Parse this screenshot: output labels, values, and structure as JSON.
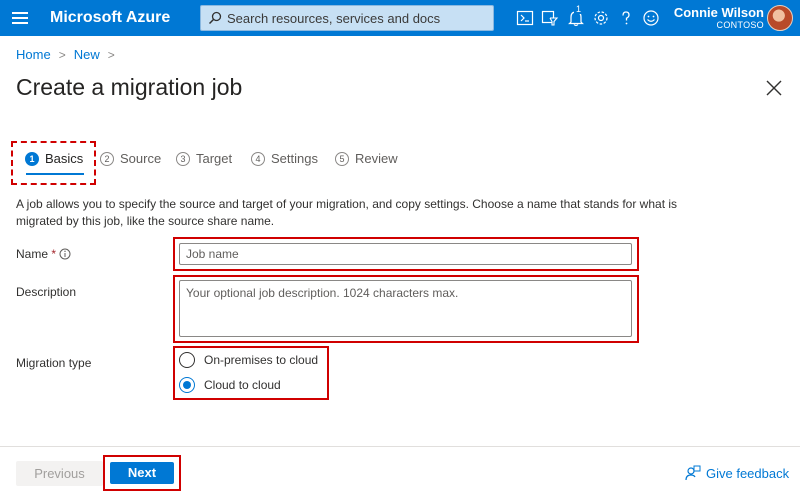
{
  "topbar": {
    "brand": "Microsoft Azure",
    "search_placeholder": "Search resources, services and docs",
    "notification_count": "1",
    "user_name": "Connie Wilson",
    "user_org": "CONTOSO",
    "icons": [
      "menu-icon",
      "search-icon",
      "cloud-shell-icon",
      "directory-filter-icon",
      "notifications-icon",
      "settings-icon",
      "help-icon",
      "feedback-smiley-icon"
    ]
  },
  "breadcrumb": {
    "home": "Home",
    "new": "New",
    "separator": ">"
  },
  "page": {
    "title": "Create a migration job"
  },
  "steps": [
    {
      "num": "1",
      "label": "Basics"
    },
    {
      "num": "2",
      "label": "Source"
    },
    {
      "num": "3",
      "label": "Target"
    },
    {
      "num": "4",
      "label": "Settings"
    },
    {
      "num": "5",
      "label": "Review"
    }
  ],
  "intro": "A job allows you to specify the source and target of your migration, and copy settings. Choose a name that stands for what is migrated by this job, like the source share name.",
  "form": {
    "name_label": "Name",
    "required_mark": "*",
    "name_placeholder": "Job name",
    "name_value": "",
    "description_label": "Description",
    "description_placeholder": "Your optional job description. 1024 characters max.",
    "description_value": "",
    "migration_type_label": "Migration type",
    "migration_options": [
      {
        "label": "On-premises to cloud",
        "checked": false
      },
      {
        "label": "Cloud to cloud",
        "checked": true
      }
    ]
  },
  "footer": {
    "previous_label": "Previous",
    "next_label": "Next",
    "feedback_label": "Give feedback"
  },
  "colors": {
    "azure_blue": "#0078d4",
    "highlight_red": "#d00000"
  }
}
